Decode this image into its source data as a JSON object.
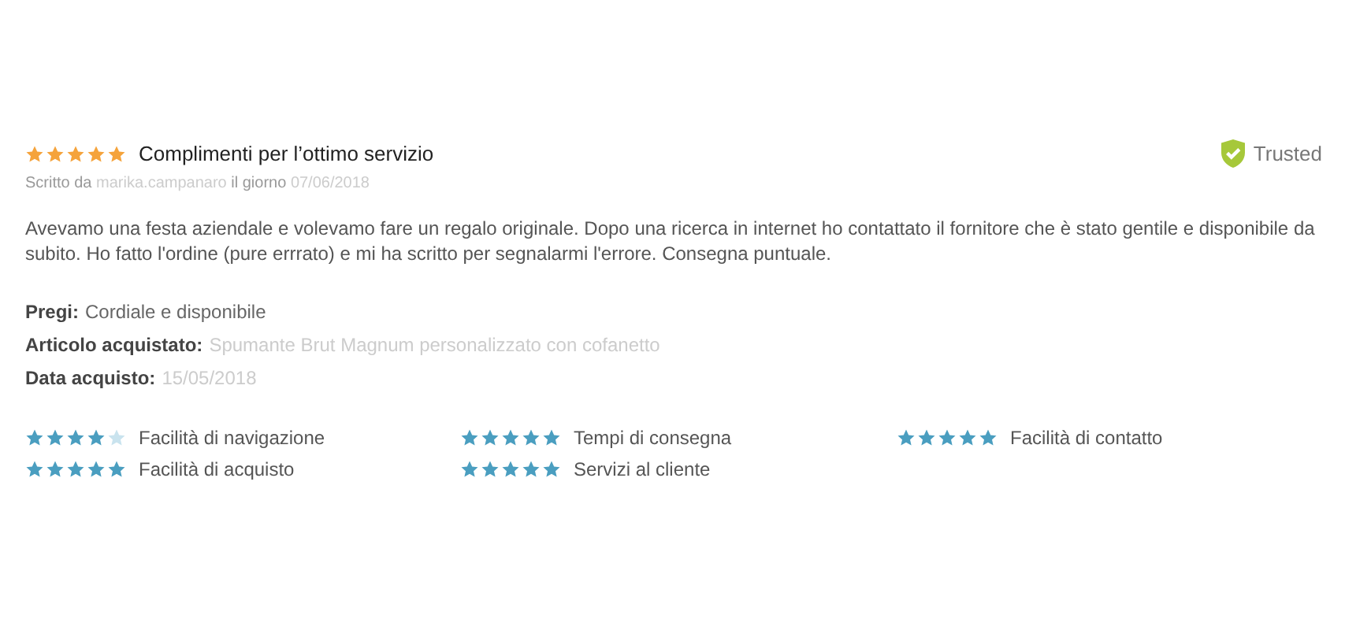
{
  "review": {
    "stars": 5,
    "title": "Complimenti per l’ottimo servizio",
    "byline": {
      "prefix": "Scritto da",
      "author": "marika.campanaro",
      "middle": "il giorno",
      "date": "07/06/2018"
    },
    "badge": "Trusted",
    "body": "Avevamo una festa aziendale e volevamo fare un regalo originale. Dopo una ricerca in internet ho contattato il fornitore che è stato gentile e disponibile da subito. Ho fatto l'ordine (pure errrato) e mi ha scritto per segnalarmi l'errore. Consegna puntuale.",
    "details": [
      {
        "label": "Pregi:",
        "value": "Cordiale e disponibile",
        "redacted": false
      },
      {
        "label": "Articolo acquistato:",
        "value": "Spumante Brut Magnum personalizzato con cofanetto",
        "redacted": true
      },
      {
        "label": "Data acquisto:",
        "value": "15/05/2018",
        "redacted": true
      }
    ],
    "ratings": [
      {
        "label": "Facilità di navigazione",
        "stars": 4
      },
      {
        "label": "Tempi di consegna",
        "stars": 5
      },
      {
        "label": "Facilità di contatto",
        "stars": 5
      },
      {
        "label": "Facilità di acquisto",
        "stars": 5
      },
      {
        "label": "Servizi al cliente",
        "stars": 5
      }
    ]
  }
}
